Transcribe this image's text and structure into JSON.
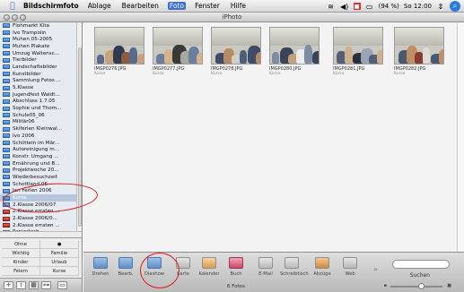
{
  "menubar": {
    "app_name": "Bildschirmfoto",
    "items": [
      "Ablage",
      "Bearbeiten",
      "Foto",
      "Fenster",
      "Hilfe"
    ],
    "active_item": "Foto",
    "battery": "(94 %)",
    "clock": "So 12:00"
  },
  "window": {
    "title": "iPhoto"
  },
  "sidebar": {
    "items": [
      {
        "label": "Flohmarkt Kita",
        "icon": "album-icon"
      },
      {
        "label": "Ivo Trampolin",
        "icon": "album-icon"
      },
      {
        "label": "Muhen 05-2005",
        "icon": "album-icon"
      },
      {
        "label": "Muhen Plakate",
        "icon": "album-icon"
      },
      {
        "label": "Umzug Waltensc...",
        "icon": "album-icon"
      },
      {
        "label": "Tierbilder",
        "icon": "album-icon"
      },
      {
        "label": "Landschaftsbilder",
        "icon": "album-icon"
      },
      {
        "label": "Kunstbilder",
        "icon": "album-icon"
      },
      {
        "label": "Sammlung Fotos ...",
        "icon": "album-icon"
      },
      {
        "label": "5.Klasse",
        "icon": "album-icon"
      },
      {
        "label": "Jugendfest Waldt...",
        "icon": "album-icon"
      },
      {
        "label": "Abschluss 1.7.05",
        "icon": "album-icon"
      },
      {
        "label": "Sophie und Thom...",
        "icon": "album-icon"
      },
      {
        "label": "Schule05_06",
        "icon": "album-icon"
      },
      {
        "label": "Militär06",
        "icon": "album-icon"
      },
      {
        "label": "Skiferien Kleinwal...",
        "icon": "album-icon"
      },
      {
        "label": "Ivo 2006",
        "icon": "album-icon"
      },
      {
        "label": "Schlittein im Mär...",
        "icon": "album-icon"
      },
      {
        "label": "Autoreinigung m...",
        "icon": "album-icon"
      },
      {
        "label": "Konstr. Umgang ...",
        "icon": "album-icon"
      },
      {
        "label": "Ernährung und B...",
        "icon": "album-icon"
      },
      {
        "label": "Projektwoche 20...",
        "icon": "album-icon"
      },
      {
        "label": "Wiederbesuchzeit",
        "icon": "album-icon"
      },
      {
        "label": "Schottland 06",
        "icon": "album-icon"
      },
      {
        "label": "Jan Ferien 2006",
        "icon": "album-icon"
      },
      {
        "label": "Kurse",
        "icon": "album-icon"
      },
      {
        "label": "2.Klasse 2006/07",
        "icon": "album-icon"
      },
      {
        "label": "2.Klasse erraten ...",
        "icon": "slideshow-icon"
      },
      {
        "label": "2.Klasse 2006/0...",
        "icon": "slideshow-icon"
      },
      {
        "label": "2.Klasse erraten ...",
        "icon": "book-icon"
      },
      {
        "label": "Papierkorb",
        "icon": "trash-icon"
      }
    ],
    "selected_index": 25
  },
  "keywords": {
    "rows": [
      [
        "Ohne",
        "●"
      ],
      [
        "Wichtig",
        "Familie"
      ],
      [
        "Kinder",
        "Urlaub"
      ],
      [
        "Feiern",
        "Kurse"
      ]
    ]
  },
  "photos": [
    {
      "name": "IMGP0276.JPG",
      "album": "Kurse"
    },
    {
      "name": "IMGP0277.JPG",
      "album": "Kurse"
    },
    {
      "name": "IMGP0278.JPG",
      "album": "Kurse"
    },
    {
      "name": "IMGP0280.JPG",
      "album": "Kurse"
    },
    {
      "name": "IMGP0281.JPG",
      "album": "Kurse"
    },
    {
      "name": "IMGP0282.JPG",
      "album": "Kurse"
    }
  ],
  "toolbar": {
    "tools": [
      "Drehen",
      "Bearb.",
      "Diashow",
      "Karte",
      "Kalender",
      "Buch",
      "E-Mail",
      "Schreibtisch",
      "Abzüge",
      "Web"
    ],
    "search_label": "Suchen",
    "photo_count": "6 Fotos",
    "zoom_level": 0.6
  },
  "colors": {
    "selection": "#3d6fd6",
    "annotation": "#e01818"
  }
}
